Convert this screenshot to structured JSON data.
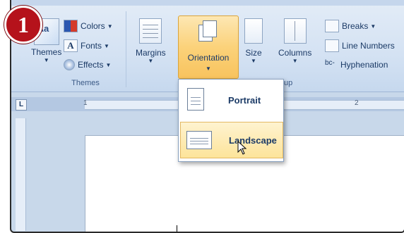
{
  "step_number": "1",
  "themes_group": {
    "label": "Themes",
    "themes_button": "Themes",
    "colors": "Colors",
    "fonts": "Fonts",
    "effects": "Effects"
  },
  "page_setup_group": {
    "margins": "Margins",
    "orientation": "Orientation",
    "size": "Size",
    "columns": "Columns",
    "breaks": "Breaks",
    "line_numbers": "Line Numbers",
    "hyphenation": "Hyphenation",
    "label_fragment": "up"
  },
  "orientation_menu": {
    "items": [
      {
        "label": "Portrait"
      },
      {
        "label": "Landscape"
      }
    ],
    "hovered": "Landscape"
  },
  "ruler": {
    "tab_selector": "L",
    "mark_1": "1",
    "mark_2": "2"
  },
  "colors": {
    "ribbon": "#d4e2f3",
    "badge": "#b5121b",
    "highlight": "#fbd27a"
  }
}
